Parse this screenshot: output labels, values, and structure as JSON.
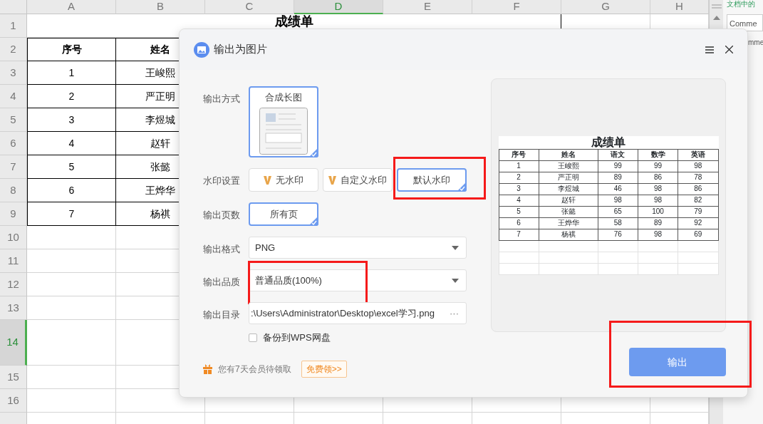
{
  "sheet": {
    "columns": [
      {
        "label": "A",
        "selected": false
      },
      {
        "label": "B",
        "selected": false
      },
      {
        "label": "C",
        "selected": false
      },
      {
        "label": "D",
        "selected": true
      },
      {
        "label": "E",
        "selected": false
      },
      {
        "label": "F",
        "selected": false
      },
      {
        "label": "G",
        "selected": false
      },
      {
        "label": "H",
        "selected": false
      }
    ],
    "rows": [
      {
        "label": "1",
        "selected": false
      },
      {
        "label": "2",
        "selected": false
      },
      {
        "label": "3",
        "selected": false
      },
      {
        "label": "4",
        "selected": false
      },
      {
        "label": "5",
        "selected": false
      },
      {
        "label": "6",
        "selected": false
      },
      {
        "label": "7",
        "selected": false
      },
      {
        "label": "8",
        "selected": false
      },
      {
        "label": "9",
        "selected": false
      },
      {
        "label": "10",
        "selected": false
      },
      {
        "label": "11",
        "selected": false
      },
      {
        "label": "12",
        "selected": false
      },
      {
        "label": "13",
        "selected": false
      },
      {
        "label": "14",
        "selected": true
      },
      {
        "label": "15",
        "selected": false
      },
      {
        "label": "16",
        "selected": false
      }
    ],
    "title": "成绩单",
    "header": [
      "序号",
      "姓名"
    ],
    "cells": [
      [
        "1",
        "王峻熙"
      ],
      [
        "2",
        "严正明"
      ],
      [
        "3",
        "李煜城"
      ],
      [
        "4",
        "赵轩"
      ],
      [
        "5",
        "张懿"
      ],
      [
        "6",
        "王烨华"
      ],
      [
        "7",
        "杨祺"
      ]
    ]
  },
  "side_panel": {
    "heading": "文档中的",
    "field": "Comme",
    "text": "mme"
  },
  "dialog": {
    "title": "输出为图片",
    "form": [
      {
        "kind": "cards",
        "label": "输出方式",
        "options": [
          {
            "label": "合成长图",
            "selected": true,
            "vip": false,
            "highlighted": false,
            "illustration": true
          }
        ]
      },
      {
        "kind": "cards",
        "label": "水印设置",
        "options": [
          {
            "label": "无水印",
            "selected": false,
            "vip": true,
            "highlighted": false,
            "illustration": false
          },
          {
            "label": "自定义水印",
            "selected": false,
            "vip": true,
            "highlighted": false,
            "illustration": false
          },
          {
            "label": "默认水印",
            "selected": true,
            "vip": false,
            "highlighted": true,
            "illustration": false
          }
        ]
      },
      {
        "kind": "cards",
        "label": "输出页数",
        "options": [
          {
            "label": "所有页",
            "selected": true,
            "vip": false,
            "highlighted": false,
            "illustration": false
          }
        ]
      },
      {
        "kind": "select",
        "label": "输出格式",
        "value": "PNG",
        "highlighted": false
      },
      {
        "kind": "select",
        "label": "输出品质",
        "value": "普通品质(100%)",
        "highlighted": true
      },
      {
        "kind": "path",
        "label": "输出目录",
        "value": ":\\Users\\Administrator\\Desktop\\excel学习.png",
        "browse": "···"
      },
      {
        "kind": "checkbox",
        "label": "备份到WPS网盘",
        "checked": false
      }
    ],
    "promo": {
      "text": "您有7天会员待领取",
      "button": "免费领>>"
    },
    "preview": {
      "title": "成绩单",
      "columns": [
        "序号",
        "姓名",
        "语文",
        "数学",
        "英语"
      ],
      "rows": [
        [
          "1",
          "王峻熙",
          "99",
          "99",
          "98"
        ],
        [
          "2",
          "严正明",
          "89",
          "86",
          "78"
        ],
        [
          "3",
          "李煜城",
          "46",
          "98",
          "86"
        ],
        [
          "4",
          "赵轩",
          "98",
          "98",
          "82"
        ],
        [
          "5",
          "张懿",
          "65",
          "100",
          "79"
        ],
        [
          "6",
          "王烨华",
          "58",
          "89",
          "92"
        ],
        [
          "7",
          "杨祺",
          "76",
          "98",
          "69"
        ]
      ]
    },
    "export_button": {
      "label": "输出",
      "highlighted": true
    }
  }
}
